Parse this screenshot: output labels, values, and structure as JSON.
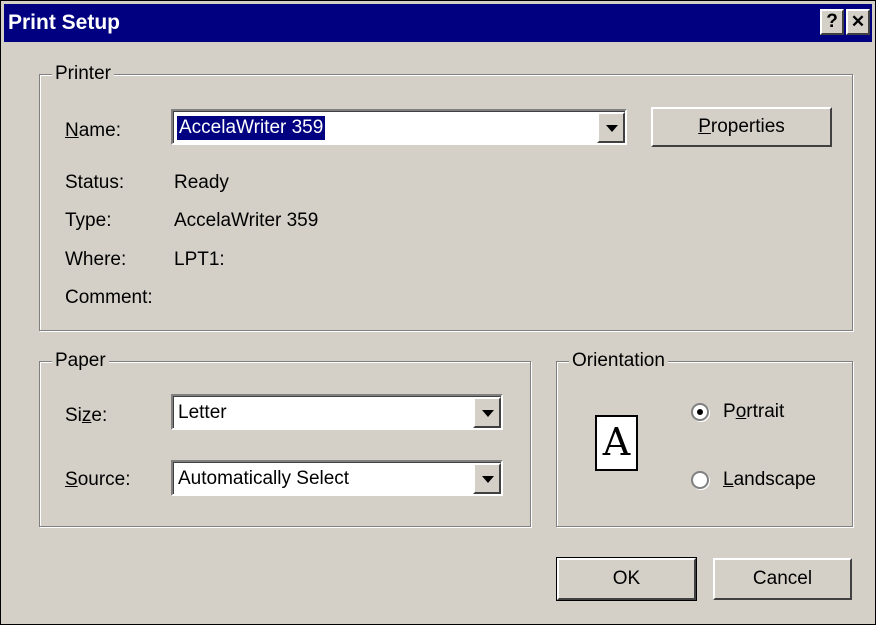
{
  "window": {
    "title": "Print Setup",
    "help_glyph": "?",
    "close_glyph": "✕"
  },
  "printer": {
    "legend": "Printer",
    "name_label_accel": "N",
    "name_label_rest": "ame:",
    "name_value": "AccelaWriter 359",
    "properties_accel": "P",
    "properties_rest": "roperties",
    "status_label": "Status:",
    "status_value": "Ready",
    "type_label": "Type:",
    "type_value": "AccelaWriter 359",
    "where_label": "Where:",
    "where_value": "LPT1:",
    "comment_label": "Comment:",
    "comment_value": ""
  },
  "paper": {
    "legend": "Paper",
    "size_label_pre": "Si",
    "size_label_accel": "z",
    "size_label_post": "e:",
    "size_value": "Letter",
    "source_label_accel": "S",
    "source_label_rest": "ource:",
    "source_value": "Automatically Select"
  },
  "orientation": {
    "legend": "Orientation",
    "icon_letter": "A",
    "portrait_accel": "o",
    "portrait_pre": "P",
    "portrait_post": "rtrait",
    "landscape_pre": "",
    "landscape_accel": "L",
    "landscape_post": "andscape",
    "selected": "portrait"
  },
  "buttons": {
    "ok": "OK",
    "cancel": "Cancel"
  }
}
